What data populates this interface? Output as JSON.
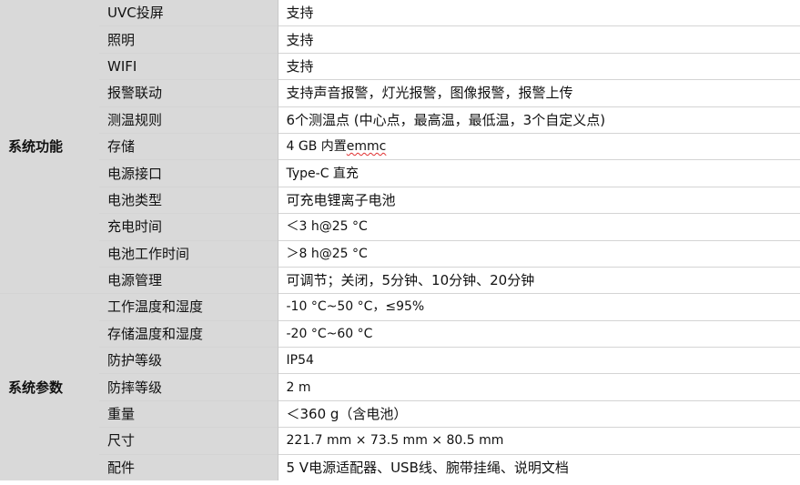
{
  "groups": [
    {
      "title": "系统功能",
      "rows": [
        {
          "name": "UVC投屏",
          "value": "支持"
        },
        {
          "name": "照明",
          "value": "支持"
        },
        {
          "name": "WIFI",
          "value": "支持"
        },
        {
          "name": "报警联动",
          "value": "支持声音报警，灯光报警，图像报警，报警上传"
        },
        {
          "name": "测温规则",
          "value": "6个测温点 (中心点，最高温，最低温，3个自定义点)"
        },
        {
          "name": "存储",
          "value_prefix": "4 GB  内置",
          "value_marked": "emmc"
        },
        {
          "name": "电源接口",
          "value": "Type-C  直充"
        },
        {
          "name": "电池类型",
          "value": "可充电锂离子电池"
        },
        {
          "name": "充电时间",
          "value": "＜3 h@25 °C"
        },
        {
          "name": "电池工作时间",
          "value": "＞8 h@25 °C"
        },
        {
          "name": "电源管理",
          "value": "可调节；关闭，5分钟、10分钟、20分钟"
        }
      ]
    },
    {
      "title": "系统参数",
      "rows": [
        {
          "name": "工作温度和湿度",
          "value": "-10 °C~50 °C，≤95%"
        },
        {
          "name": "存储温度和湿度",
          "value": "-20 °C~60 °C"
        },
        {
          "name": "防护等级",
          "value": "IP54"
        },
        {
          "name": "防摔等级",
          "value": "2 m"
        },
        {
          "name": "重量",
          "value": "＜360 g（含电池）"
        },
        {
          "name": "尺寸",
          "value": "221.7 mm × 73.5 mm × 80.5 mm"
        },
        {
          "name": "配件",
          "value": "5 V电源适配器、USB线、腕带挂绳、说明文档"
        }
      ]
    }
  ]
}
